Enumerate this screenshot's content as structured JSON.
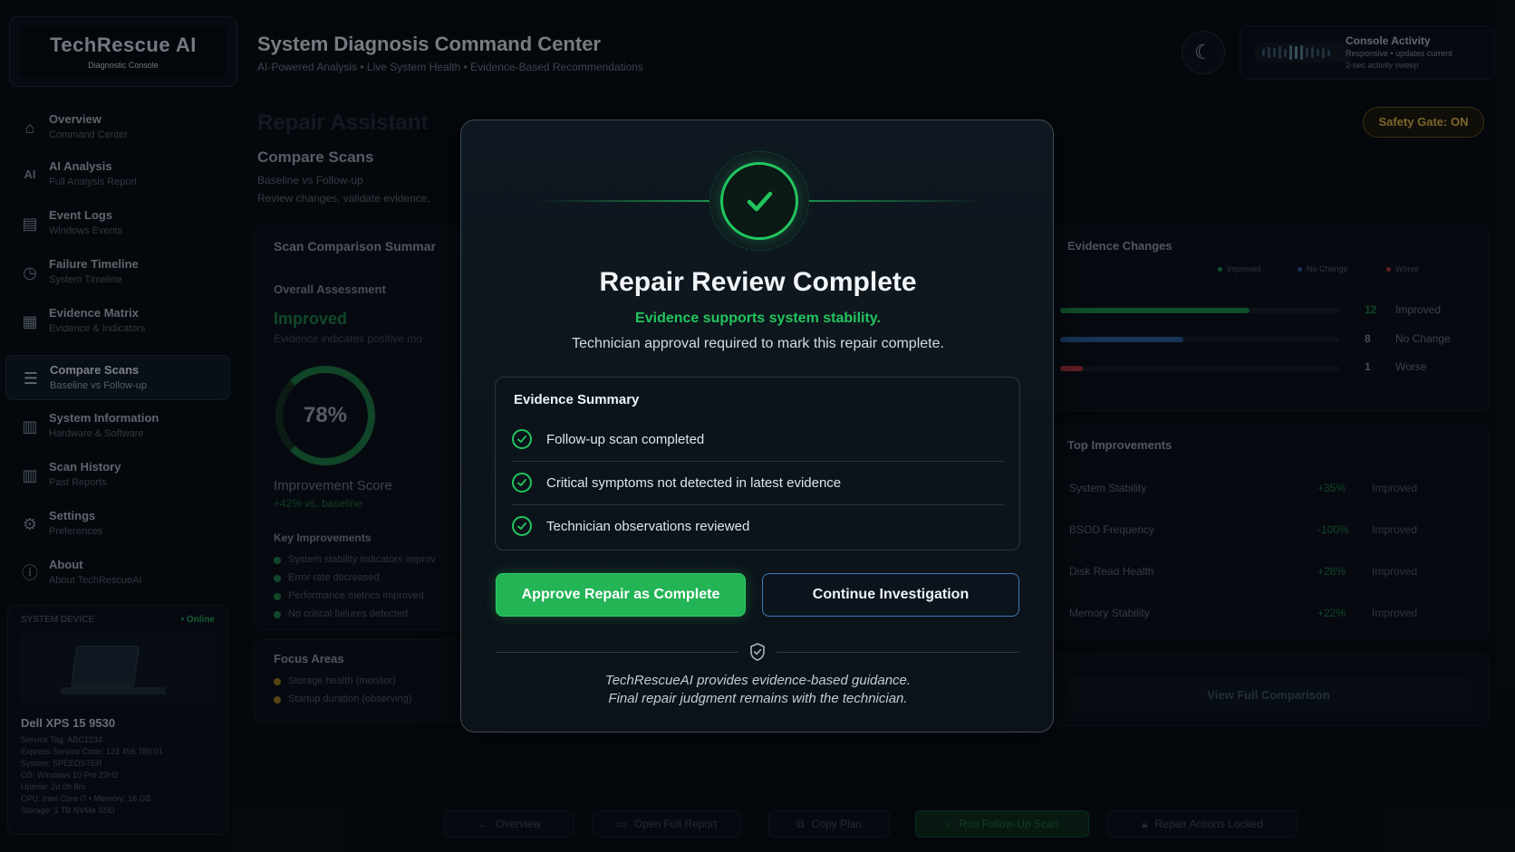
{
  "brand": {
    "name": "TechRescue AI",
    "tagline": "Diagnostic Console"
  },
  "header": {
    "title": "System Diagnosis Command Center",
    "subtitle": "AI-Powered Analysis  •  Live System Health  •  Evidence-Based Recommendations"
  },
  "activity": {
    "title": "Console Activity",
    "line1": "Responsive • updates current",
    "line2": "2-sec activity sweep"
  },
  "sidebar": {
    "items": [
      {
        "label": "Overview",
        "sub": "Command Center",
        "icon": "home-icon"
      },
      {
        "label": "AI Analysis",
        "sub": "Full Analysis Report",
        "icon": "ai-icon"
      },
      {
        "label": "Event Logs",
        "sub": "Windows Events",
        "icon": "document-icon"
      },
      {
        "label": "Failure Timeline",
        "sub": "System Timeline",
        "icon": "clock-icon"
      },
      {
        "label": "Evidence Matrix",
        "sub": "Evidence & Indicators",
        "icon": "grid-icon"
      },
      {
        "label": "Compare Scans",
        "sub": "Baseline vs Follow-up",
        "icon": "list-icon",
        "active": true
      },
      {
        "label": "System Information",
        "sub": "Hardware & Software",
        "icon": "chart-icon"
      },
      {
        "label": "Scan History",
        "sub": "Past Reports",
        "icon": "history-icon"
      },
      {
        "label": "Settings",
        "sub": "Preferences",
        "icon": "gear-icon"
      },
      {
        "label": "About",
        "sub": "About TechRescueAI",
        "icon": "info-icon"
      }
    ]
  },
  "device": {
    "heading": "SYSTEM DEVICE",
    "status": "• Online",
    "name": "Dell XPS 15 9530",
    "details": [
      "Service Tag: ABC1234",
      "Express Service Code: 123 456 789 01",
      "System: SPEEDSTER",
      "OS: Windows 10 Pro 22H2",
      "Uptime: 2d 0h 8m",
      "CPU: Intel Core i7  •  Memory: 16 GB",
      "Storage: 1 TB NVMe SSD"
    ]
  },
  "main": {
    "page_title": "Repair Assistant",
    "section_title": "Compare Scans",
    "section_sub1": "Baseline vs Follow-up",
    "section_sub2": "Review changes, validate evidence,",
    "safety_gate": "Safety Gate: ON",
    "summary": {
      "title": "Scan Comparison Summar",
      "assessment_label": "Overall Assessment",
      "assessment_value": "Improved",
      "assessment_note": "Evidence indicates positive mo",
      "score_text": "78%",
      "score_label": "Improvement Score",
      "score_delta": "+42% vs. baseline",
      "key_title": "Key Improvements",
      "key_items": [
        "System stability indicators improv",
        "Error rate decreased",
        "Performance metrics improved",
        "No critical failures detected"
      ]
    },
    "focus": {
      "title": "Focus Areas",
      "items": [
        "Storage health (monitor)",
        "Startup duration (observing)"
      ]
    },
    "evidence_changes": {
      "title": "Evidence Changes",
      "legend": [
        "Improved",
        "No Change",
        "Worse"
      ],
      "rows": [
        {
          "count": "12",
          "label": "Improved",
          "fraction": 0.68,
          "color": "#1c8a4a"
        },
        {
          "count": "8",
          "label": "No Change",
          "fraction": 0.44,
          "color": "#2b5d98"
        },
        {
          "count": "1",
          "label": "Worse",
          "fraction": 0.08,
          "color": "#b3343c"
        }
      ]
    },
    "top_improvements": {
      "title": "Top Improvements",
      "rows": [
        {
          "name": "System Stability",
          "value": "+35%",
          "status": "Improved"
        },
        {
          "name": "BSOD Frequency",
          "value": "-100%",
          "status": "Improved"
        },
        {
          "name": "Disk Read Health",
          "value": "+28%",
          "status": "Improved"
        },
        {
          "name": "Memory Stability",
          "value": "+22%",
          "status": "Improved"
        }
      ]
    },
    "view_full": "View Full Comparison"
  },
  "bottom_bar": {
    "overview": "Overview",
    "open_report": "Open Full Report",
    "copy_plan": "Copy Plan",
    "run_scan": "Run Follow-Up Scan",
    "locked": "Repair Actions Locked"
  },
  "modal": {
    "title": "Repair Review Complete",
    "subtitle": "Evidence supports system stability.",
    "note": "Technician approval required to mark this repair complete.",
    "evidence_title": "Evidence Summary",
    "evidence_items": [
      "Follow-up scan completed",
      "Critical symptoms not detected in latest evidence",
      "Technician observations reviewed"
    ],
    "approve_label": "Approve Repair as Complete",
    "continue_label": "Continue Investigation",
    "footer_line1": "TechRescueAI provides evidence-based guidance.",
    "footer_line2": "Final repair judgment remains with the technician."
  },
  "colors": {
    "accent_green": "#22c55e",
    "accent_blue": "#3e78b8",
    "safety_amber": "#e1b648"
  }
}
